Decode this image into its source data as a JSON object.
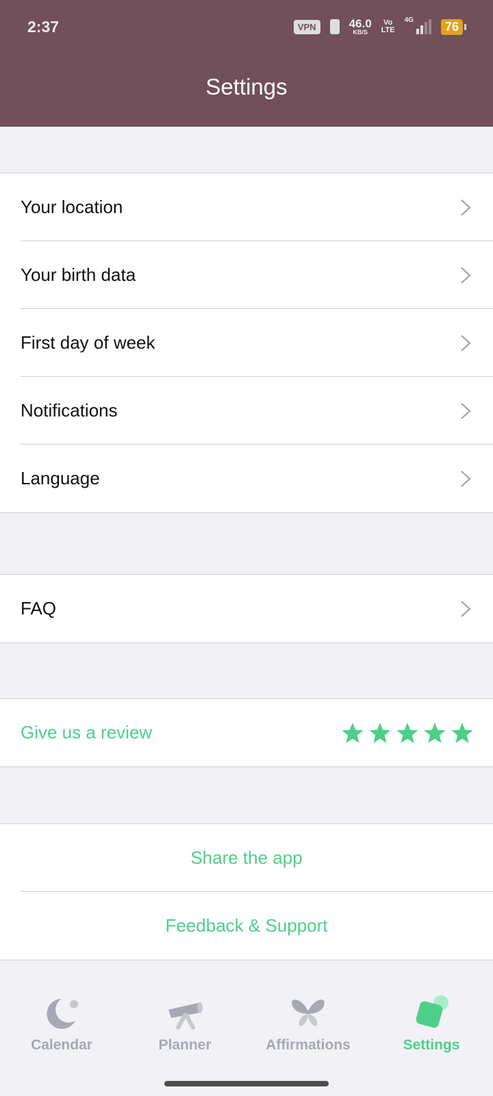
{
  "status_bar": {
    "time": "2:37",
    "vpn": "VPN",
    "speed_value": "46.0",
    "speed_unit": "KB/S",
    "volte_top": "Vo",
    "volte_bottom": "LTE",
    "network": "4G",
    "battery": "76"
  },
  "header": {
    "title": "Settings"
  },
  "settings_group": {
    "items": [
      {
        "label": "Your location"
      },
      {
        "label": "Your birth data"
      },
      {
        "label": "First day of week"
      },
      {
        "label": "Notifications"
      },
      {
        "label": "Language"
      }
    ]
  },
  "faq": {
    "label": "FAQ"
  },
  "review": {
    "label": "Give us a review",
    "stars": 5
  },
  "share": {
    "label": "Share the app"
  },
  "feedback": {
    "label": "Feedback & Support"
  },
  "tabs": [
    {
      "label": "Calendar",
      "icon": "moon-icon",
      "active": false
    },
    {
      "label": "Planner",
      "icon": "telescope-icon",
      "active": false
    },
    {
      "label": "Affirmations",
      "icon": "butterfly-icon",
      "active": false
    },
    {
      "label": "Settings",
      "icon": "settings-icon",
      "active": true
    }
  ],
  "colors": {
    "accent": "#4ecf89",
    "header": "#714f5b",
    "inactive_tab": "#a6a9b2"
  }
}
